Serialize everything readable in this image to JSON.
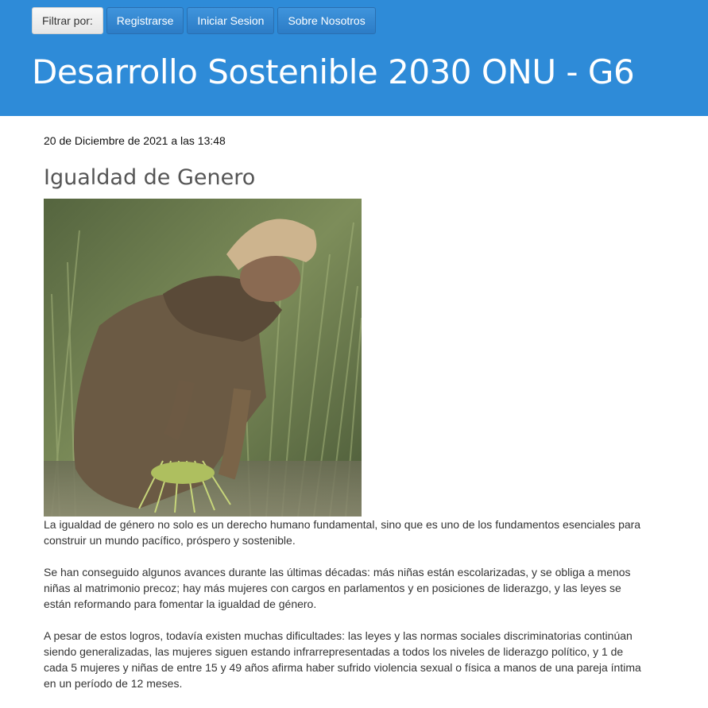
{
  "nav": {
    "filter_label": "Filtrar por:",
    "items": [
      "Registrarse",
      "Iniciar Sesion",
      "Sobre Nosotros"
    ]
  },
  "site": {
    "title": "Desarrollo Sostenible 2030 ONU - G6"
  },
  "post": {
    "date": "20 de Diciembre de 2021 a las 13:48",
    "title": "Igualdad de Genero",
    "paragraphs": [
      "La igualdad de género no solo es un derecho humano fundamental, sino que es uno de los fundamentos esenciales para construir un mundo pacífico, próspero y sostenible.",
      "Se han conseguido algunos avances durante las últimas décadas: más niñas están escolarizadas, y se obliga a menos niñas al matrimonio precoz; hay más mujeres con cargos en parlamentos y en posiciones de liderazgo, y las leyes se están reformando para fomentar la igualdad de género.",
      "A pesar de estos logros, todavía existen muchas dificultades: las leyes y las normas sociales discriminatorias continúan siendo generalizadas, las mujeres siguen estando infrarrepresentadas a todos los niveles de liderazgo político, y 1 de cada 5 mujeres y niñas de entre 15 y 49 años afirma haber sufrido violencia sexual o física a manos de una pareja íntima en un período de 12 meses."
    ]
  },
  "colors": {
    "header_bg": "#2e8bd8",
    "nav_button_bg": "#2c7cc6",
    "filter_button_bg": "#e6e6e6"
  }
}
